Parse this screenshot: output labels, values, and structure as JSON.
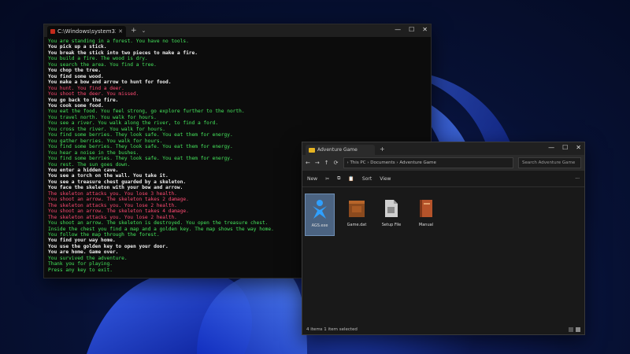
{
  "terminal": {
    "tab_title": "C:\\Windows\\system32\\cmd.exe",
    "plus": "+",
    "dropdown": "⌄",
    "close": "✕",
    "controls": {
      "min": "—",
      "max": "☐",
      "close": "✕"
    },
    "lines": [
      {
        "text": "You are standing in a forest. You have no tools.",
        "c": "green"
      },
      {
        "text": "You pick up a stick.",
        "c": "white"
      },
      {
        "text": "You break the stick into two pieces to make a fire.",
        "c": "white"
      },
      {
        "text": "You build a fire. The wood is dry.",
        "c": "green"
      },
      {
        "text": "You search the area. You find a tree.",
        "c": "green"
      },
      {
        "text": "You chop the tree.",
        "c": "white"
      },
      {
        "text": "You find some wood.",
        "c": "white"
      },
      {
        "text": "You make a bow and arrow to hunt for food.",
        "c": "white"
      },
      {
        "text": "You hunt. You find a deer.",
        "c": "red"
      },
      {
        "text": "You shoot the deer. You missed.",
        "c": "red"
      },
      {
        "text": "You go back to the fire.",
        "c": "white"
      },
      {
        "text": "You cook some food.",
        "c": "white"
      },
      {
        "text": "You eat the food. You feel strong, go explore further to the north.",
        "c": "green"
      },
      {
        "text": "You travel north. You walk for hours.",
        "c": "green"
      },
      {
        "text": "You see a river. You walk along the river, to find a ford.",
        "c": "green"
      },
      {
        "text": "You cross the river. You walk for hours.",
        "c": "green"
      },
      {
        "text": "You find some berries. They look safe. You eat them for energy.",
        "c": "green"
      },
      {
        "text": "You gather berries. You walk for hours.",
        "c": "green"
      },
      {
        "text": "You find some berries. They look safe. You eat them for energy.",
        "c": "green"
      },
      {
        "text": "You hear a noise in the bushes.",
        "c": "green"
      },
      {
        "text": "You find some berries. They look safe. You eat them for energy.",
        "c": "green"
      },
      {
        "text": "You rest. The sun goes down.",
        "c": "green"
      },
      {
        "text": "You enter a hidden cave.",
        "c": "white"
      },
      {
        "text": "You see a torch on the wall. You take it.",
        "c": "white"
      },
      {
        "text": "You see a treasure chest guarded by a skeleton.",
        "c": "white"
      },
      {
        "text": "You face the skeleton with your bow and arrow.",
        "c": "white"
      },
      {
        "text": "The skeleton attacks you. You lose 3 health.",
        "c": "red"
      },
      {
        "text": "You shoot an arrow. The skeleton takes 2 damage.",
        "c": "red"
      },
      {
        "text": "The skeleton attacks you. You lose 2 health.",
        "c": "red"
      },
      {
        "text": "You shoot an arrow. The skeleton takes 4 damage.",
        "c": "red"
      },
      {
        "text": "The skeleton attacks you. You lose 2 health.",
        "c": "red"
      },
      {
        "text": "You shoot an arrow. The skeleton is destroyed. You open the treasure chest.",
        "c": "green"
      },
      {
        "text": "Inside the chest you find a map and a golden key. The map shows the way home.",
        "c": "green"
      },
      {
        "text": "You follow the map through the forest.",
        "c": "green"
      },
      {
        "text": "You find your way home.",
        "c": "white"
      },
      {
        "text": "You use the golden key to open your door.",
        "c": "white"
      },
      {
        "text": "You are home. Game over.",
        "c": "white"
      },
      {
        "text": "You survived the adventure.",
        "c": "green"
      },
      {
        "text": "Thank you for playing.",
        "c": "green"
      },
      {
        "text": "Press any key to exit.",
        "c": "green"
      }
    ]
  },
  "explorer": {
    "tab_title": "Adventure Game",
    "plus": "+",
    "address": "  ›  This PC  ›  Documents  ›  Adventure Game",
    "search_placeholder": "Search Adventure Game",
    "toolbar": {
      "new": "New",
      "cut": "✂",
      "copy": "⧉",
      "paste": "📋",
      "sort": "Sort",
      "view": "View",
      "more": "···"
    },
    "files": [
      {
        "label": "AGS.exe",
        "icon": "person-icon"
      },
      {
        "label": "Game.dat",
        "icon": "box-icon"
      },
      {
        "label": "Setup File",
        "icon": "doc-icon"
      },
      {
        "label": "Manual",
        "icon": "book-icon"
      }
    ],
    "status": "4 items   1 item selected",
    "controls": {
      "min": "—",
      "max": "☐",
      "close": "✕"
    }
  },
  "colors": {
    "green": "#45e55c",
    "white": "#f0f0f0",
    "red": "#ff4a73",
    "desktop": "#0d1a55",
    "bloom": "#2a4bff"
  }
}
